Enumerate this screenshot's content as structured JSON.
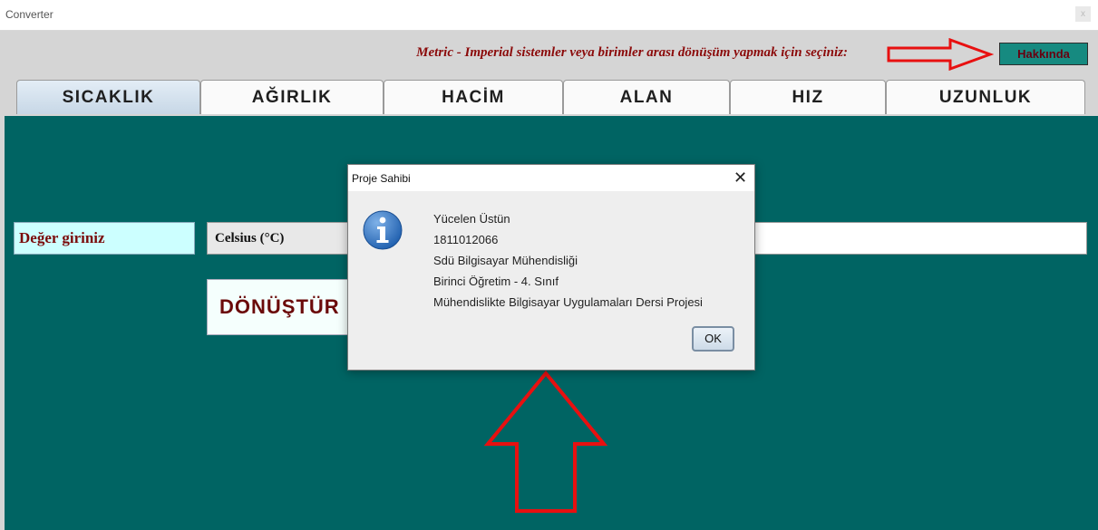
{
  "window": {
    "title": "Converter",
    "close_label": "x"
  },
  "header": {
    "prompt": "Metric - Imperial sistemler veya birimler arası dönüşüm yapmak için seçiniz:",
    "about_button": "Hakkında"
  },
  "tabs": [
    {
      "label": "SICAKLIK",
      "active": true
    },
    {
      "label": "AĞIRLIK",
      "active": false
    },
    {
      "label": "HACİM",
      "active": false
    },
    {
      "label": "ALAN",
      "active": false
    },
    {
      "label": "HIZ",
      "active": false
    },
    {
      "label": "UZUNLUK",
      "active": false
    }
  ],
  "form": {
    "value_label": "Değer giriniz",
    "unit_selected": "Celsius (°C)",
    "convert_button": "DÖNÜŞTÜR",
    "result_value": ""
  },
  "dialog": {
    "title": "Proje Sahibi",
    "icon": "info-icon",
    "lines": [
      "Yücelen Üstün",
      "1811012066",
      "Sdü Bilgisayar Mühendisliği",
      "Birinci Öğretim - 4. Sınıf",
      "Mühendislikte Bilgisayar Uygulamaları Dersi Projesi"
    ],
    "ok_button": "OK"
  },
  "colors": {
    "content_bg": "#006463",
    "label_bg": "#ccffff",
    "accent_red": "#8b0a0a",
    "about_bg": "#168a80",
    "annotation_arrow": "#e81010"
  }
}
